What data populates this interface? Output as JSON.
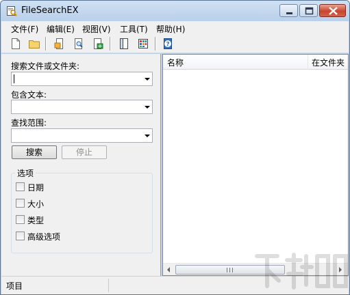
{
  "window": {
    "title": "FileSearchEX"
  },
  "menu": {
    "items": [
      "文件(F)",
      "编辑(E)",
      "视图(V)",
      "工具(T)",
      "帮助(H)"
    ]
  },
  "toolbar": {
    "icons": [
      "new-file-icon",
      "open-folder-icon",
      "page-icon",
      "page-find-icon",
      "page-export-icon",
      "panel-icon",
      "grid-icon",
      "help-icon"
    ]
  },
  "search": {
    "name_label": "搜索文件或文件夹:",
    "name_value": "",
    "text_label": "包含文本:",
    "text_value": "",
    "scope_label": "查找范围:",
    "scope_value": "",
    "search_button": "搜索",
    "stop_button": "停止"
  },
  "options": {
    "title": "选项",
    "items": [
      {
        "label": "日期",
        "checked": false
      },
      {
        "label": "大小",
        "checked": false
      },
      {
        "label": "类型",
        "checked": false
      },
      {
        "label": "高级选项",
        "checked": false
      }
    ]
  },
  "results": {
    "columns": [
      "名称",
      "在文件夹"
    ],
    "scroll_glyph": "III"
  },
  "status": {
    "text": "项目"
  },
  "colors": {
    "title_bar": "#bcd2ea",
    "close_button": "#c8452f",
    "panel": "#f0f0f0"
  }
}
